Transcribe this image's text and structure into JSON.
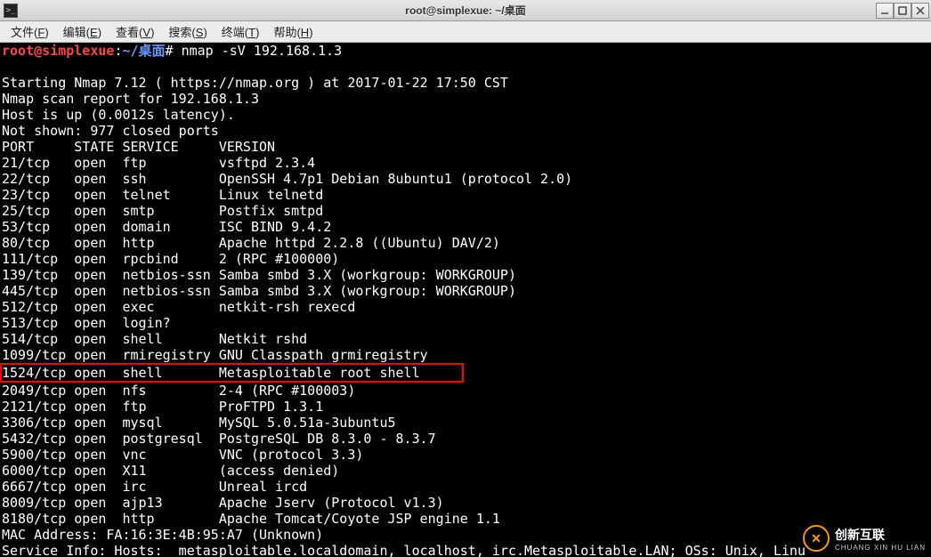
{
  "titlebar": {
    "title": "root@simplexue: ~/桌面"
  },
  "window_controls": {
    "minimize": "minimize-icon",
    "maximize": "maximize-icon",
    "close": "close-icon"
  },
  "menubar": {
    "items": [
      {
        "label": "文件",
        "accel": "F"
      },
      {
        "label": "编辑",
        "accel": "E"
      },
      {
        "label": "查看",
        "accel": "V"
      },
      {
        "label": "搜索",
        "accel": "S"
      },
      {
        "label": "终端",
        "accel": "T"
      },
      {
        "label": "帮助",
        "accel": "H"
      }
    ]
  },
  "prompt": {
    "user_host": "root@simplexue",
    "colon": ":",
    "path": "~/桌面",
    "symbol": "#",
    "command": " nmap -sV 192.168.1.3"
  },
  "output": {
    "blank1": "",
    "l1": "Starting Nmap 7.12 ( https://nmap.org ) at 2017-01-22 17:50 CST",
    "l2": "Nmap scan report for 192.168.1.3",
    "l3": "Host is up (0.0012s latency).",
    "l4": "Not shown: 977 closed ports",
    "header": "PORT     STATE SERVICE     VERSION",
    "rows": [
      "21/tcp   open  ftp         vsftpd 2.3.4",
      "22/tcp   open  ssh         OpenSSH 4.7p1 Debian 8ubuntu1 (protocol 2.0)",
      "23/tcp   open  telnet      Linux telnetd",
      "25/tcp   open  smtp        Postfix smtpd",
      "53/tcp   open  domain      ISC BIND 9.4.2",
      "80/tcp   open  http        Apache httpd 2.2.8 ((Ubuntu) DAV/2)",
      "111/tcp  open  rpcbind     2 (RPC #100000)",
      "139/tcp  open  netbios-ssn Samba smbd 3.X (workgroup: WORKGROUP)",
      "445/tcp  open  netbios-ssn Samba smbd 3.X (workgroup: WORKGROUP)",
      "512/tcp  open  exec        netkit-rsh rexecd",
      "513/tcp  open  login?",
      "514/tcp  open  shell       Netkit rshd",
      "1099/tcp open  rmiregistry GNU Classpath grmiregistry"
    ],
    "highlighted": "1524/tcp open  shell       Metasploitable root shell     ",
    "rows2": [
      "2049/tcp open  nfs         2-4 (RPC #100003)",
      "2121/tcp open  ftp         ProFTPD 1.3.1",
      "3306/tcp open  mysql       MySQL 5.0.51a-3ubuntu5",
      "5432/tcp open  postgresql  PostgreSQL DB 8.3.0 - 8.3.7",
      "5900/tcp open  vnc         VNC (protocol 3.3)",
      "6000/tcp open  X11         (access denied)",
      "6667/tcp open  irc         Unreal ircd",
      "8009/tcp open  ajp13       Apache Jserv (Protocol v1.3)",
      "8180/tcp open  http        Apache Tomcat/Coyote JSP engine 1.1"
    ],
    "mac": "MAC Address: FA:16:3E:4B:95:A7 (Unknown)",
    "svc": "Service Info: Hosts:  metasploitable.localdomain, localhost, irc.Metasploitable.LAN; OSs: Unix, Linu"
  },
  "watermark": {
    "brand": "创新互联",
    "sub": "CHUANG XIN HU LIAN",
    "logo_text": "✕"
  }
}
